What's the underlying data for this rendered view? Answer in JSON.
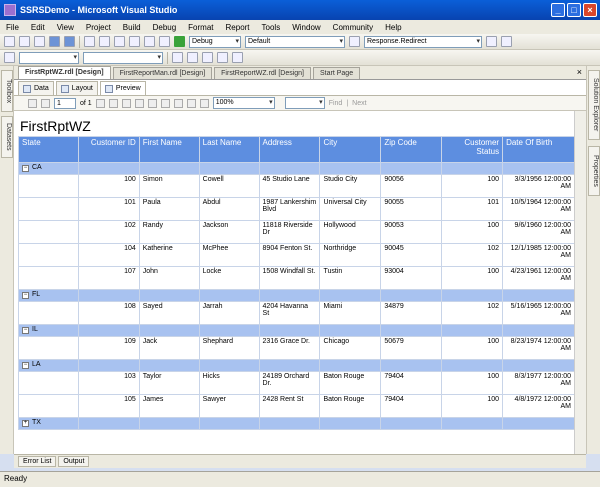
{
  "window": {
    "title": "SSRSDemo - Microsoft Visual Studio"
  },
  "menu": [
    "File",
    "Edit",
    "View",
    "Project",
    "Build",
    "Debug",
    "Format",
    "Report",
    "Tools",
    "Window",
    "Community",
    "Help"
  ],
  "toolbar": {
    "config": "Debug",
    "platform": "Default",
    "find": "Response.Redirect"
  },
  "left_tabs": [
    "Toolbox",
    "Datasets"
  ],
  "right_tabs": [
    "Solution Explorer",
    "Properties"
  ],
  "doc_tabs": [
    "FirstRptWZ.rdl [Design]",
    "FirstReportMan.rdl [Design]",
    "FirstReportWZ.rdl [Design]",
    "Start Page"
  ],
  "view_tabs": [
    "Data",
    "Layout",
    "Preview"
  ],
  "report_toolbar": {
    "page": "1",
    "of_label": "of 1",
    "zoom": "100%",
    "find_label": "Find",
    "next_label": "Next"
  },
  "report": {
    "title": "FirstRptWZ",
    "headers": [
      "State",
      "Customer ID",
      "First Name",
      "Last Name",
      "Address",
      "City",
      "Zip Code",
      "Customer Status",
      "Date Of Birth"
    ],
    "groups": [
      {
        "state": "CA",
        "rows": [
          [
            "100",
            "Simon",
            "Cowell",
            "45 Studio Lane",
            "Studio City",
            "90056",
            "100",
            "3/3/1956 12:00:00 AM"
          ],
          [
            "101",
            "Paula",
            "Abdul",
            "1987 Lankershim Blvd",
            "Universal City",
            "90055",
            "101",
            "10/5/1964 12:00:00 AM"
          ],
          [
            "102",
            "Randy",
            "Jackson",
            "11818 Riverside Dr",
            "Hollywood",
            "90053",
            "100",
            "9/6/1960 12:00:00 AM"
          ],
          [
            "104",
            "Katherine",
            "McPhee",
            "8904 Fenton St.",
            "Northridge",
            "90045",
            "102",
            "12/1/1985 12:00:00 AM"
          ],
          [
            "107",
            "John",
            "Locke",
            "1508 Windfall St.",
            "Tustin",
            "93004",
            "100",
            "4/23/1961 12:00:00 AM"
          ]
        ]
      },
      {
        "state": "FL",
        "rows": [
          [
            "108",
            "Sayed",
            "Jarrah",
            "4204 Havanna St",
            "Miami",
            "34879",
            "102",
            "5/16/1965 12:00:00 AM"
          ]
        ]
      },
      {
        "state": "IL",
        "rows": [
          [
            "109",
            "Jack",
            "Shephard",
            "2316 Grace Dr.",
            "Chicago",
            "50679",
            "100",
            "8/23/1974 12:00:00 AM"
          ]
        ]
      },
      {
        "state": "LA",
        "rows": [
          [
            "103",
            "Taylor",
            "Hicks",
            "24189 Orchard Dr.",
            "Baton Rouge",
            "79404",
            "100",
            "8/3/1977 12:00:00 AM"
          ],
          [
            "105",
            "James",
            "Sawyer",
            "2428 Rent St",
            "Baton Rouge",
            "79404",
            "100",
            "4/8/1972 12:00:00 AM"
          ]
        ]
      },
      {
        "state": "TX",
        "rows": []
      }
    ]
  },
  "bottom_tabs": [
    "Error List",
    "Output"
  ],
  "status": "Ready",
  "colors": {
    "header_bg": "#5d8ee0",
    "group_bg": "#a8c2f0",
    "titlebar": "#0a5fd8"
  }
}
